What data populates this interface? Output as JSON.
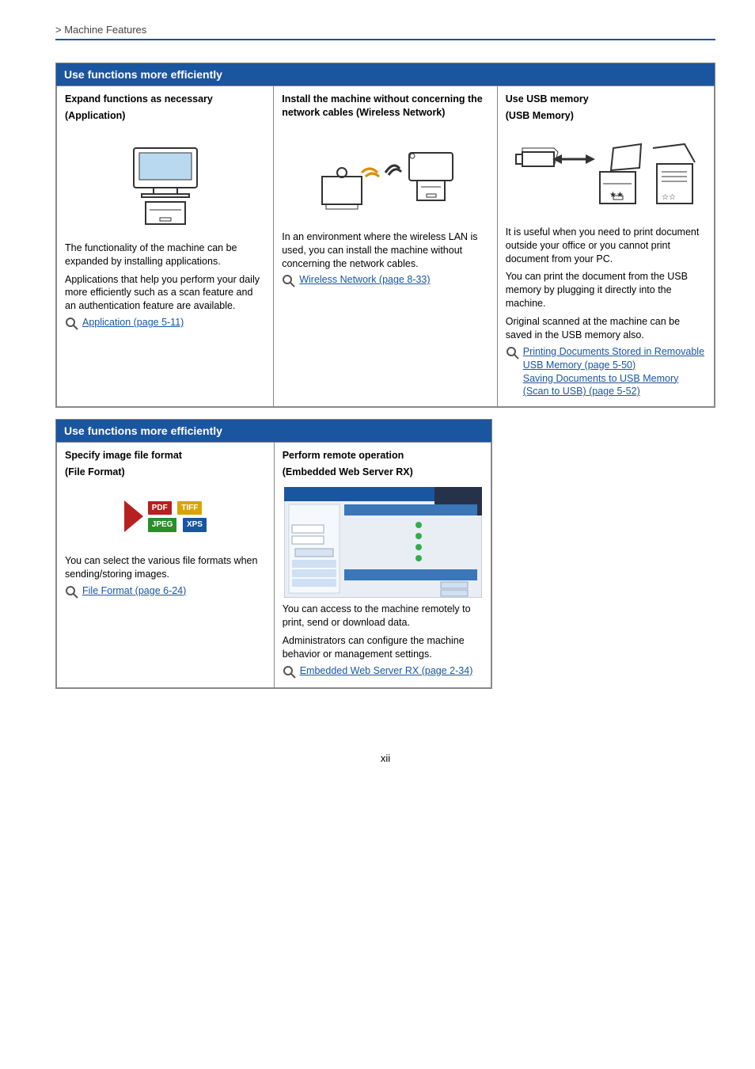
{
  "header": {
    "breadcrumb": " > Machine Features"
  },
  "pageNumber": "xii",
  "box1": {
    "title": "Use functions more efficiently",
    "cols": [
      {
        "head1": "Expand functions as necessary",
        "head2": "(Application)",
        "para1": "The functionality of the machine can be expanded by installing applications.",
        "para2": "Applications that help you perform your daily more efficiently such as a scan feature and an authentication feature are available.",
        "link1": "Application (page 5-11)"
      },
      {
        "head1": "Install the machine without concerning the network cables (Wireless Network)",
        "para1": "In an environment where the wireless LAN is used, you can install the machine without concerning the network cables.",
        "link1": "Wireless Network (page 8-33)"
      },
      {
        "head1": "Use USB memory",
        "head2": "(USB Memory)",
        "para1": "It is useful when you need to print document outside your office or you cannot print document from your PC.",
        "para2": "You can print the document from the USB memory by plugging it directly into the machine.",
        "para3": "Original scanned at the machine can be saved in the USB memory also.",
        "link1": "Printing Documents Stored in Removable USB Memory (page 5-50)",
        "link2": "Saving Documents to USB Memory (Scan to USB) (page 5-52)"
      }
    ]
  },
  "box2": {
    "title": "Use functions more efficiently",
    "cols": [
      {
        "head1": "Specify image file format",
        "head2": "(File Format)",
        "badges": {
          "pdf": "PDF",
          "tiff": "TIFF",
          "jpeg": "JPEG",
          "xps": "XPS"
        },
        "para1": "You can select the various file formats when sending/storing images.",
        "link1": "File Format (page 6-24)"
      },
      {
        "head1": "Perform remote operation",
        "head2": "(Embedded Web Server RX)",
        "para1": "You can access to the machine remotely to print, send or download data.",
        "para2": "Administrators can configure the machine behavior or management settings.",
        "link1": "Embedded Web Server RX (page 2-34)"
      }
    ]
  }
}
